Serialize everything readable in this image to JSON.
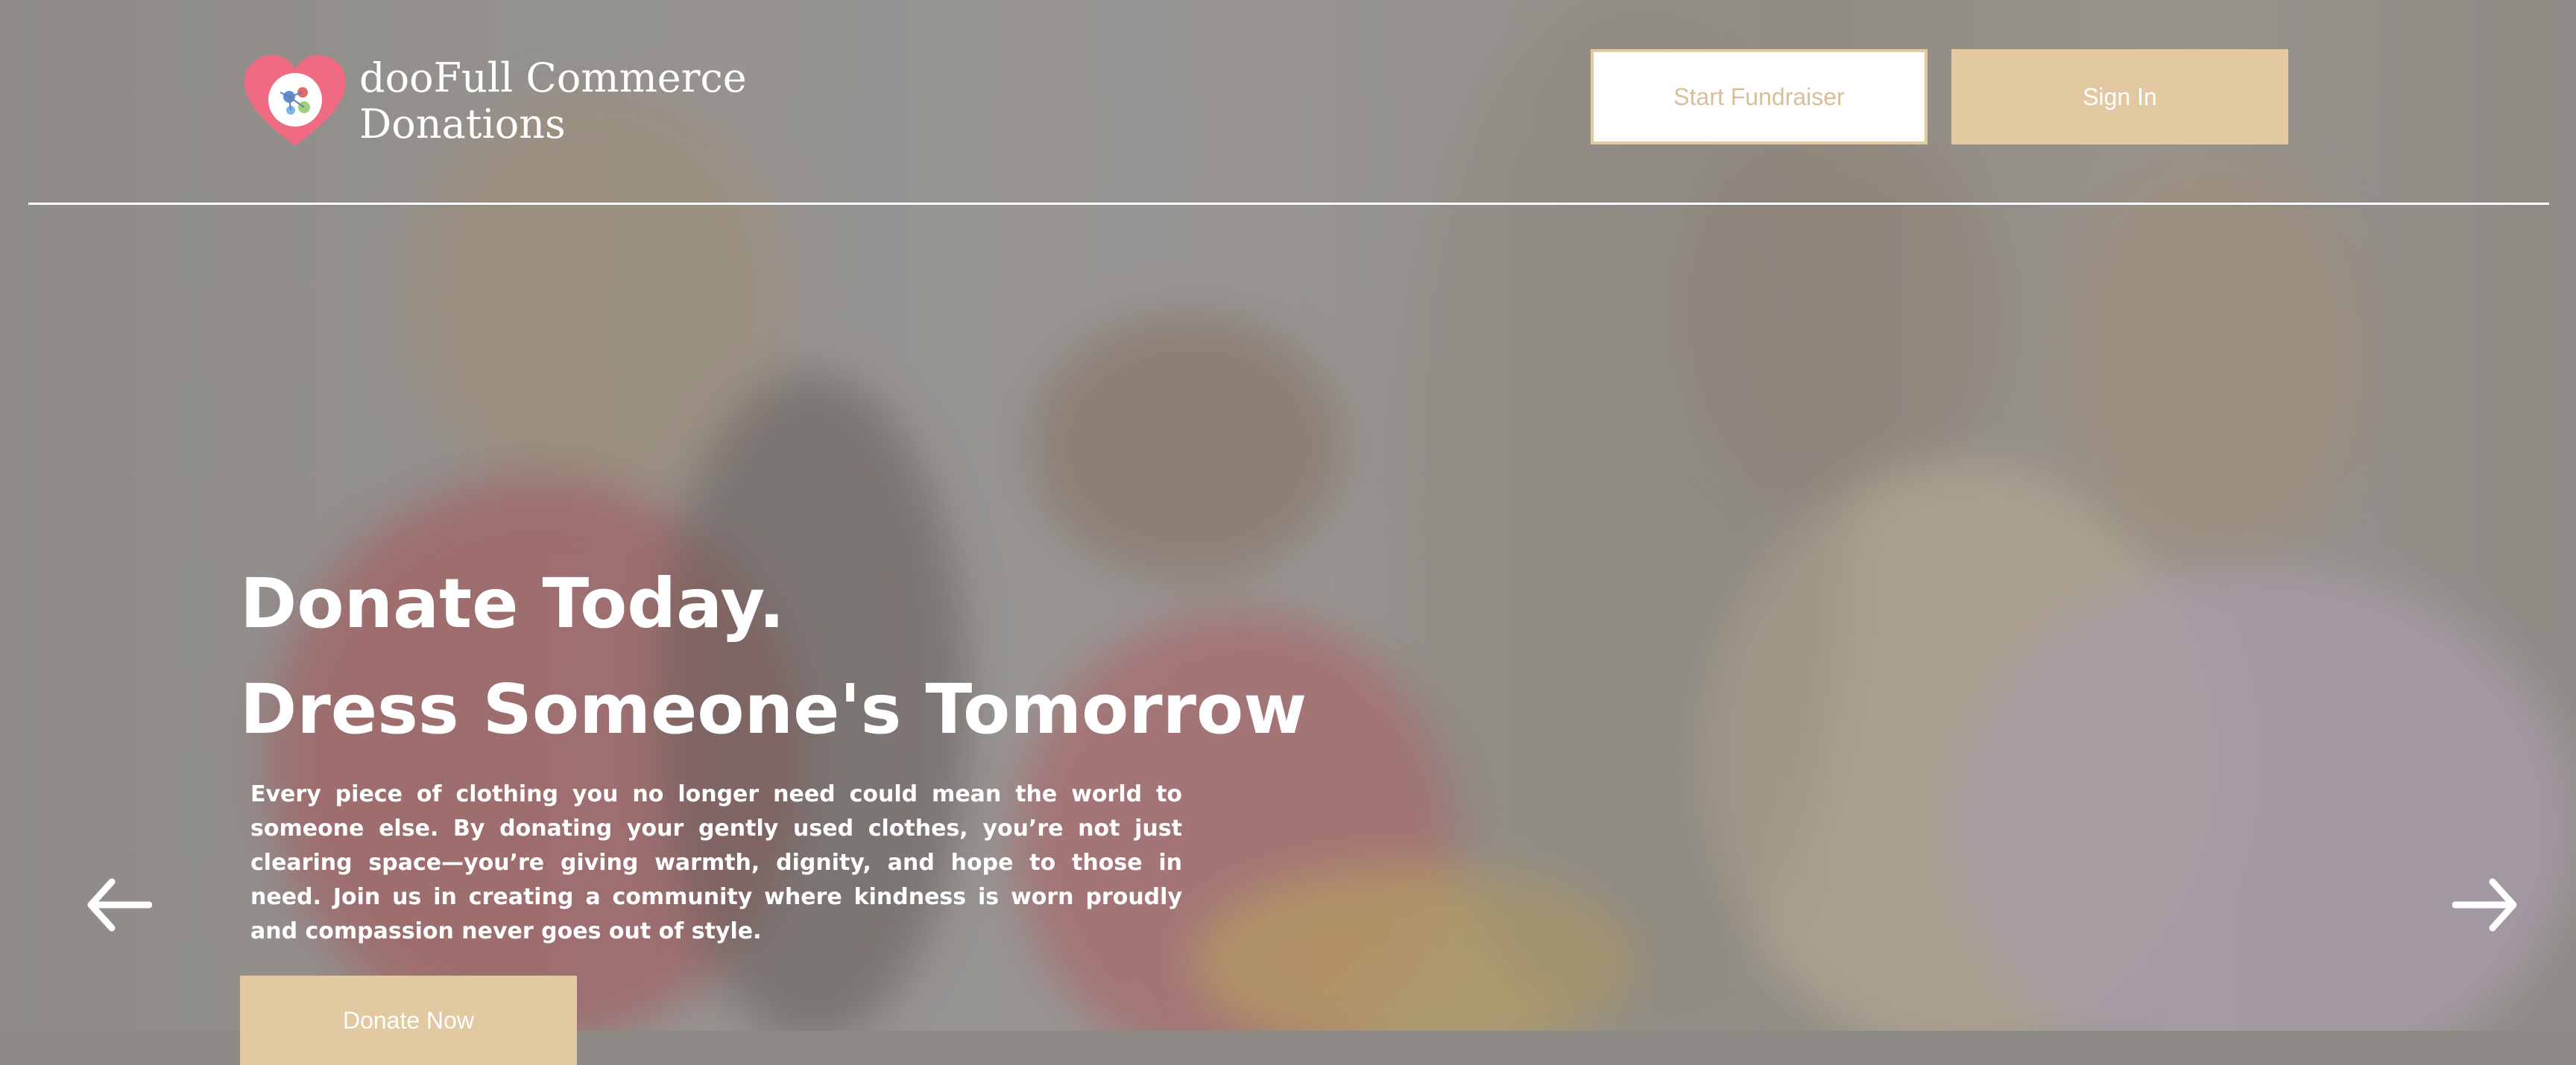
{
  "brand": {
    "name_line1": "dooFull Commerce",
    "name_line2": "Donations",
    "logo_icon": "heart-logo-icon"
  },
  "header": {
    "start_fundraiser_label": "Start Fundraiser",
    "sign_in_label": "Sign In"
  },
  "hero": {
    "title_line1": "Donate Today.",
    "title_line2": "Dress Someone's Tomorrow",
    "description": "Every piece of clothing you no longer need could mean the world to someone else. By donating your gently used clothes, you’re not just clearing space—you’re giving warmth, dignity, and hope to those in need. Join us in creating a community where kindness is worn proudly and compassion never goes out of style.",
    "cta_label": "Donate Now",
    "prev_icon": "arrow-left-icon",
    "next_icon": "arrow-right-icon"
  },
  "colors": {
    "accent": "#e2c9a2",
    "logo_pink": "#f06b82"
  }
}
